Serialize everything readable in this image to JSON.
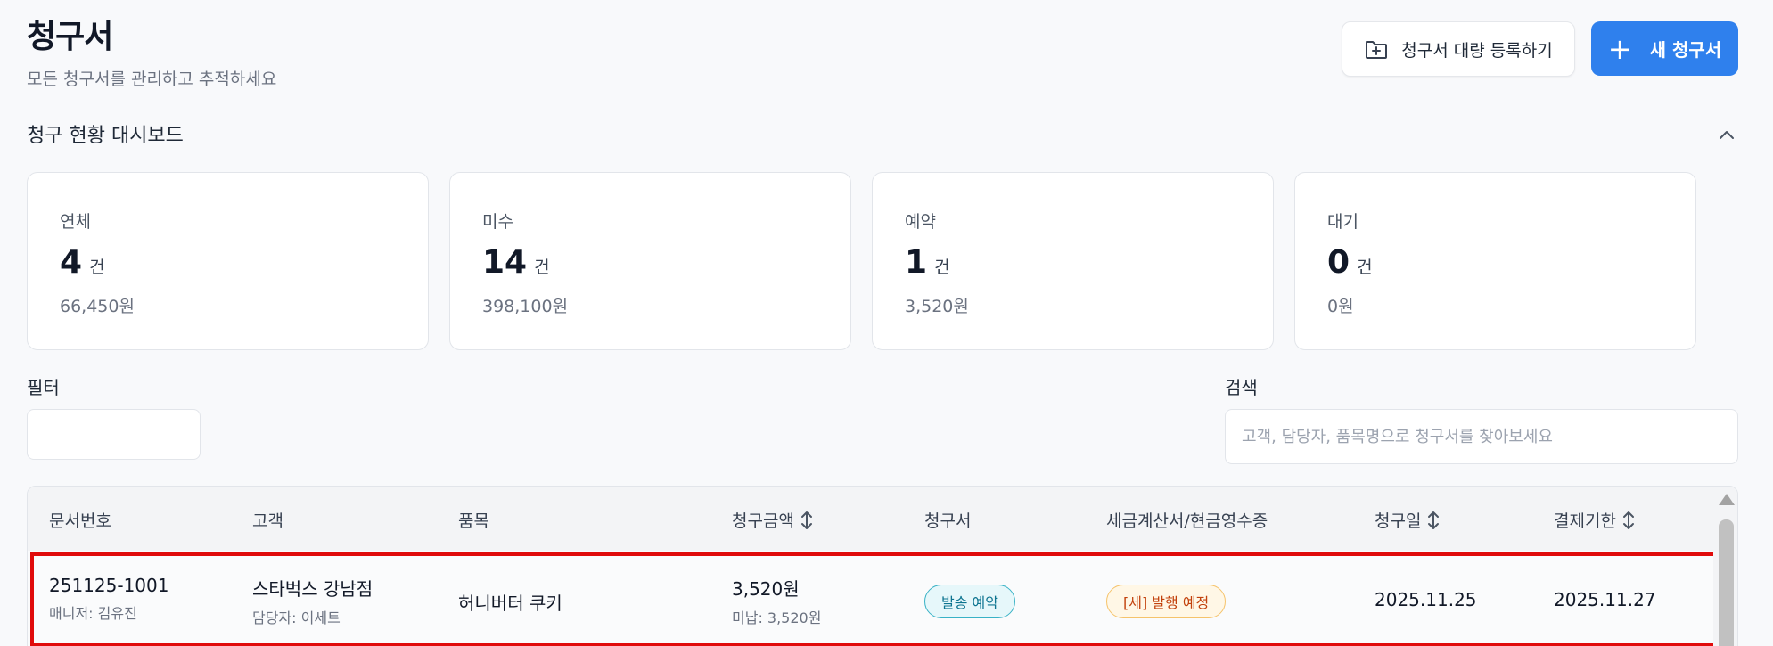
{
  "header": {
    "title": "청구서",
    "subtitle": "모든 청구서를 관리하고 추적하세요",
    "bulk_button": "청구서 대량 등록하기",
    "new_button": "새 청구서"
  },
  "dashboard": {
    "title": "청구 현황 대시보드",
    "cards": [
      {
        "label": "연체",
        "count": "4",
        "unit": "건",
        "amount": "66,450원"
      },
      {
        "label": "미수",
        "count": "14",
        "unit": "건",
        "amount": "398,100원"
      },
      {
        "label": "예약",
        "count": "1",
        "unit": "건",
        "amount": "3,520원"
      },
      {
        "label": "대기",
        "count": "0",
        "unit": "건",
        "amount": "0원"
      }
    ]
  },
  "filter": {
    "label": "필터",
    "value": ""
  },
  "search": {
    "label": "검색",
    "placeholder": "고객, 담당자, 품목명으로 청구서를 찾아보세요",
    "value": ""
  },
  "table": {
    "columns": [
      "문서번호",
      "고객",
      "품목",
      "청구금액",
      "청구서",
      "세금계산서/현금영수증",
      "청구일",
      "결제기한"
    ],
    "rows": [
      {
        "doc_no": "251125-1001",
        "manager": "매니저: 김유진",
        "customer": "스타벅스 강남점",
        "contact": "담당자: 이세트",
        "item": "허니버터 쿠키",
        "amount": "3,520원",
        "unpaid": "미납: 3,520원",
        "invoice_status": "발송 예약",
        "tax_status": "[세] 발행 예정",
        "bill_date": "2025.11.25",
        "due_date": "2025.11.27"
      }
    ]
  },
  "colors": {
    "primary": "#2f80ed",
    "highlight": "#e00b0b",
    "badge_send": "#0e7490",
    "badge_tax": "#c2410c"
  }
}
